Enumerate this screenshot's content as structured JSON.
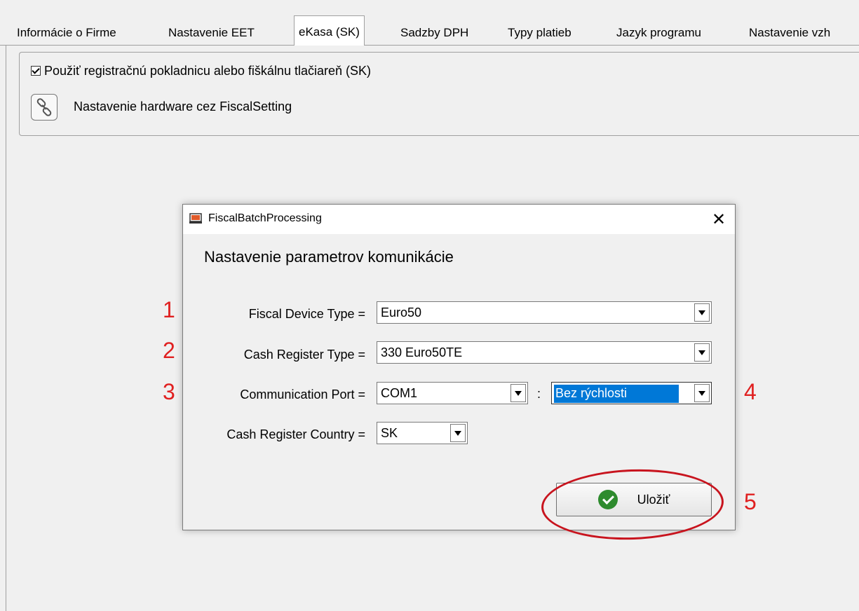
{
  "tabs": [
    {
      "label": "Informácie o Firme"
    },
    {
      "label": "Nastavenie EET"
    },
    {
      "label": "eKasa (SK)",
      "active": true
    },
    {
      "label": "Sadzby DPH"
    },
    {
      "label": "Typy platieb"
    },
    {
      "label": "Jazyk programu"
    },
    {
      "label": "Nastavenie vzh"
    }
  ],
  "settings": {
    "use_register_label": "Použiť registračnú pokladnicu alebo fiškálnu tlačiareň (SK)",
    "use_register_checked": true,
    "hardware_label": "Nastavenie hardware cez FiscalSetting",
    "hardware_icon": "link-icon"
  },
  "dialog": {
    "title": "FiscalBatchProcessing",
    "heading": "Nastavenie parametrov komunikácie",
    "close_symbol": "✕",
    "fields": {
      "fiscal_device_type": {
        "label": "Fiscal Device Type =",
        "value": "Euro50"
      },
      "cash_register_type": {
        "label": "Cash Register Type =",
        "value": "330  Euro50TE"
      },
      "communication_port": {
        "label": "Communication Port =",
        "value": "COM1"
      },
      "speed": {
        "value": "Bez rýchlosti"
      },
      "cash_register_country": {
        "label": "Cash Register Country =",
        "value": "SK"
      }
    },
    "colon": ":",
    "save_label": "Uložiť"
  },
  "annotations": {
    "n1": "1",
    "n2": "2",
    "n3": "3",
    "n4": "4",
    "n5": "5",
    "color": "#e02020"
  }
}
